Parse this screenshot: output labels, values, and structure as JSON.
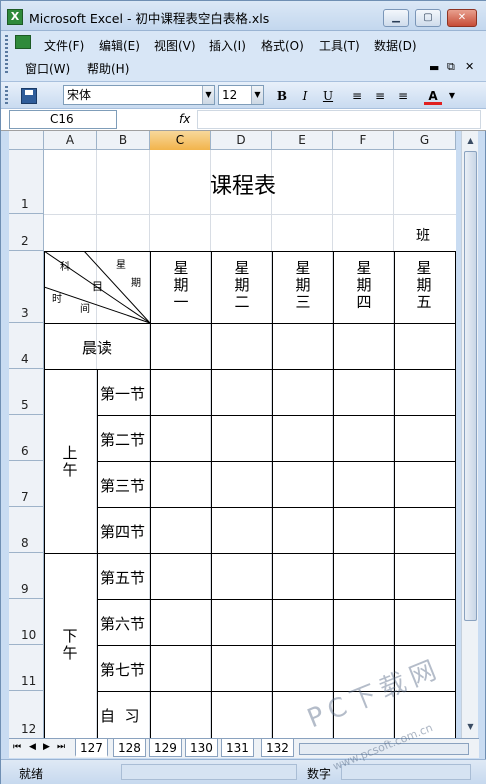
{
  "window": {
    "title": "Microsoft Excel - 初中课程表空白表格.xls",
    "app_icon": "X"
  },
  "menu": {
    "items": [
      "文件(F)",
      "编辑(E)",
      "视图(V)",
      "插入(I)",
      "格式(O)",
      "工具(T)",
      "数据(D)"
    ],
    "items2": [
      "窗口(W)",
      "帮助(H)"
    ]
  },
  "toolbar": {
    "font": "宋体",
    "size": "12",
    "bold": "B",
    "italic": "I",
    "underline": "U",
    "font_color_label": "A"
  },
  "formula": {
    "name_box": "C16",
    "fx": "fx",
    "value": ""
  },
  "columns": [
    "A",
    "B",
    "C",
    "D",
    "E",
    "F",
    "G"
  ],
  "rows": [
    "1",
    "2",
    "3",
    "4",
    "5",
    "6",
    "7",
    "8",
    "9",
    "10",
    "11",
    "12"
  ],
  "selected_column": "C",
  "table": {
    "title": "课程表",
    "class_label": "班",
    "diag": {
      "ke": "科",
      "xing": "星",
      "mu": "目",
      "qi": "期",
      "shi": "时",
      "jian": "间"
    },
    "days": [
      "星\n期\n一",
      "星\n期\n二",
      "星\n期\n三",
      "星\n期\n四",
      "星\n期\n五"
    ],
    "morning_read": "晨读",
    "am": "上\n午",
    "pm": "下\n午",
    "periods": [
      "第一节",
      "第二节",
      "第三节",
      "第四节",
      "第五节",
      "第六节",
      "第七节",
      "自  习"
    ]
  },
  "sheet_tabs": [
    "127",
    "128",
    "129",
    "130",
    "131",
    "132"
  ],
  "active_tab": "127",
  "status": {
    "ready": "就绪",
    "mode": "数字"
  },
  "watermark": {
    "big": "PC下载网",
    "small": "www.pcsoft.com.cn"
  }
}
